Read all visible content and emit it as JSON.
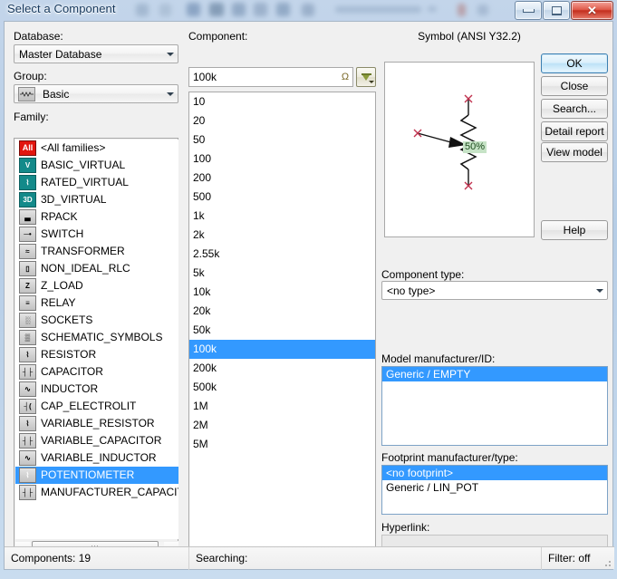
{
  "window": {
    "title": "Select a Component",
    "controls": {
      "minimize": "minimize",
      "maximize": "maximize",
      "close": "close"
    }
  },
  "left": {
    "database_label": "Database:",
    "database_value": "Master Database",
    "group_label": "Group:",
    "group_value": "Basic",
    "group_icon": "resistor-icon",
    "family_label": "Family:",
    "families": [
      {
        "label": "<All families>",
        "icon": "All",
        "icon_kind": "all"
      },
      {
        "label": "BASIC_VIRTUAL",
        "icon": "V",
        "icon_kind": "teal"
      },
      {
        "label": "RATED_VIRTUAL",
        "icon": "⌇",
        "icon_kind": "teal"
      },
      {
        "label": "3D_VIRTUAL",
        "icon": "3D",
        "icon_kind": "teal"
      },
      {
        "label": "RPACK",
        "icon": "▃",
        "icon_kind": "gray"
      },
      {
        "label": "SWITCH",
        "icon": "─•",
        "icon_kind": "gray"
      },
      {
        "label": "TRANSFORMER",
        "icon": "≈",
        "icon_kind": "gray"
      },
      {
        "label": "NON_IDEAL_RLC",
        "icon": "▯",
        "icon_kind": "gray"
      },
      {
        "label": "Z_LOAD",
        "icon": "Z",
        "icon_kind": "gray"
      },
      {
        "label": "RELAY",
        "icon": "≡",
        "icon_kind": "gray"
      },
      {
        "label": "SOCKETS",
        "icon": "░",
        "icon_kind": "gray"
      },
      {
        "label": "SCHEMATIC_SYMBOLS",
        "icon": "▒",
        "icon_kind": "gray"
      },
      {
        "label": "RESISTOR",
        "icon": "⌇",
        "icon_kind": "gray"
      },
      {
        "label": "CAPACITOR",
        "icon": "┤├",
        "icon_kind": "gray"
      },
      {
        "label": "INDUCTOR",
        "icon": "∿",
        "icon_kind": "gray"
      },
      {
        "label": "CAP_ELECTROLIT",
        "icon": "┤(",
        "icon_kind": "gray"
      },
      {
        "label": "VARIABLE_RESISTOR",
        "icon": "⌇",
        "icon_kind": "gray"
      },
      {
        "label": "VARIABLE_CAPACITOR",
        "icon": "┤├",
        "icon_kind": "gray"
      },
      {
        "label": "VARIABLE_INDUCTOR",
        "icon": "∿",
        "icon_kind": "gray"
      },
      {
        "label": "POTENTIOMETER",
        "icon": "⌇",
        "icon_kind": "gray",
        "selected": true
      },
      {
        "label": "MANUFACTURER_CAPACITOR",
        "icon": "┤├",
        "icon_kind": "gray"
      }
    ]
  },
  "middle": {
    "component_label": "Component:",
    "component_value": "100k",
    "unit_symbol": "Ω",
    "filter_icon": "filter-funnel-icon",
    "items": [
      "10",
      "20",
      "50",
      "100",
      "200",
      "500",
      "1k",
      "2k",
      "2.55k",
      "5k",
      "10k",
      "20k",
      "50k",
      "100k",
      "200k",
      "500k",
      "1M",
      "2M",
      "5M"
    ],
    "selected_item": "100k"
  },
  "right": {
    "symbol_label": "Symbol (ANSI Y32.2)",
    "symbol_percent": "50%",
    "component_type_label": "Component type:",
    "component_type_value": "<no type>",
    "model_label": "Model manufacturer/ID:",
    "model_items": [
      "Generic / EMPTY"
    ],
    "model_selected": "Generic / EMPTY",
    "footprint_label": "Footprint manufacturer/type:",
    "footprint_items": [
      "<no footprint>",
      "Generic / LIN_POT"
    ],
    "footprint_selected": "<no footprint>",
    "hyperlink_label": "Hyperlink:",
    "hyperlink_value": ""
  },
  "buttons": {
    "ok": "OK",
    "close": "Close",
    "search": "Search...",
    "detail_report": "Detail report",
    "view_model": "View model",
    "help": "Help"
  },
  "statusbar": {
    "components": "Components: 19",
    "searching": "Searching:",
    "filter": "Filter: off"
  },
  "colors": {
    "selection_blue": "#3399ff",
    "title_blue": "#14375c",
    "percent_bg": "#c6e3c6",
    "dialog_bg": "#f0f0f0",
    "close_red": "#c42f1e"
  }
}
